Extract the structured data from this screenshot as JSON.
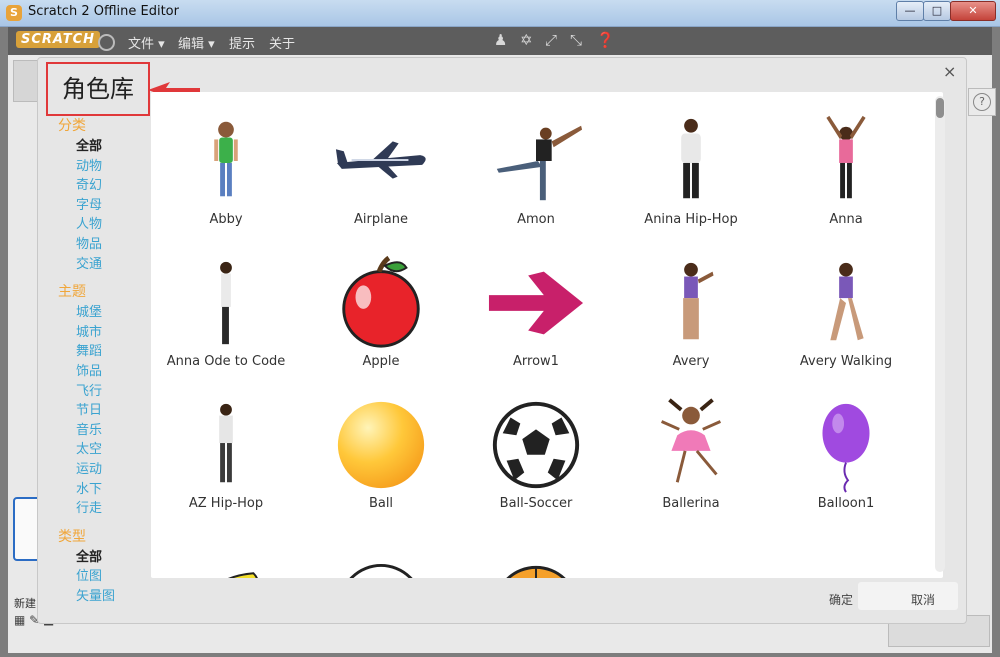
{
  "window": {
    "title": "Scratch 2 Offline Editor",
    "app_icon": "cat-icon"
  },
  "menubar": {
    "logo": "SCRATCH",
    "menus": [
      "文件 ▾",
      "编辑 ▾",
      "提示",
      "关于"
    ],
    "tools": [
      "duplicate-stamp-icon",
      "cut-icon",
      "grow-icon",
      "shrink-icon",
      "help-icon"
    ]
  },
  "dialog": {
    "title": "角色库",
    "close": "×",
    "ok_label": "确定",
    "cancel_label": "取消"
  },
  "sidebar": {
    "sections": [
      {
        "heading": "分类",
        "items": [
          "全部",
          "动物",
          "奇幻",
          "字母",
          "人物",
          "物品",
          "交通"
        ],
        "active": 0
      },
      {
        "heading": "主题",
        "items": [
          "城堡",
          "城市",
          "舞蹈",
          "饰品",
          "飞行",
          "节日",
          "音乐",
          "太空",
          "运动",
          "水下",
          "行走"
        ],
        "active": -1
      },
      {
        "heading": "类型",
        "items": [
          "全部",
          "位图",
          "矢量图"
        ],
        "active": 0
      }
    ]
  },
  "sprites": [
    {
      "name": "Abby",
      "icon": "girl-standing"
    },
    {
      "name": "Airplane",
      "icon": "airplane"
    },
    {
      "name": "Amon",
      "icon": "dancer-kick"
    },
    {
      "name": "Anina Hip-Hop",
      "icon": "hiphop-girl"
    },
    {
      "name": "Anna",
      "icon": "girl-arms-up"
    },
    {
      "name": "Anna Ode to Code",
      "icon": "girl-side"
    },
    {
      "name": "Apple",
      "icon": "apple"
    },
    {
      "name": "Arrow1",
      "icon": "arrow"
    },
    {
      "name": "Avery",
      "icon": "girl-wave"
    },
    {
      "name": "Avery Walking",
      "icon": "girl-walk"
    },
    {
      "name": "AZ Hip-Hop",
      "icon": "boy-standing"
    },
    {
      "name": "Ball",
      "icon": "yellow-ball"
    },
    {
      "name": "Ball-Soccer",
      "icon": "soccer-ball"
    },
    {
      "name": "Ballerina",
      "icon": "ballerina"
    },
    {
      "name": "Balloon1",
      "icon": "purple-balloon"
    },
    {
      "name": "",
      "icon": "bananas"
    },
    {
      "name": "",
      "icon": "baseball"
    },
    {
      "name": "",
      "icon": "basketball"
    },
    {
      "name": "",
      "icon": "bat"
    },
    {
      "name": "",
      "icon": "bat"
    }
  ],
  "workspace": {
    "new_sprite_label": "新建"
  }
}
